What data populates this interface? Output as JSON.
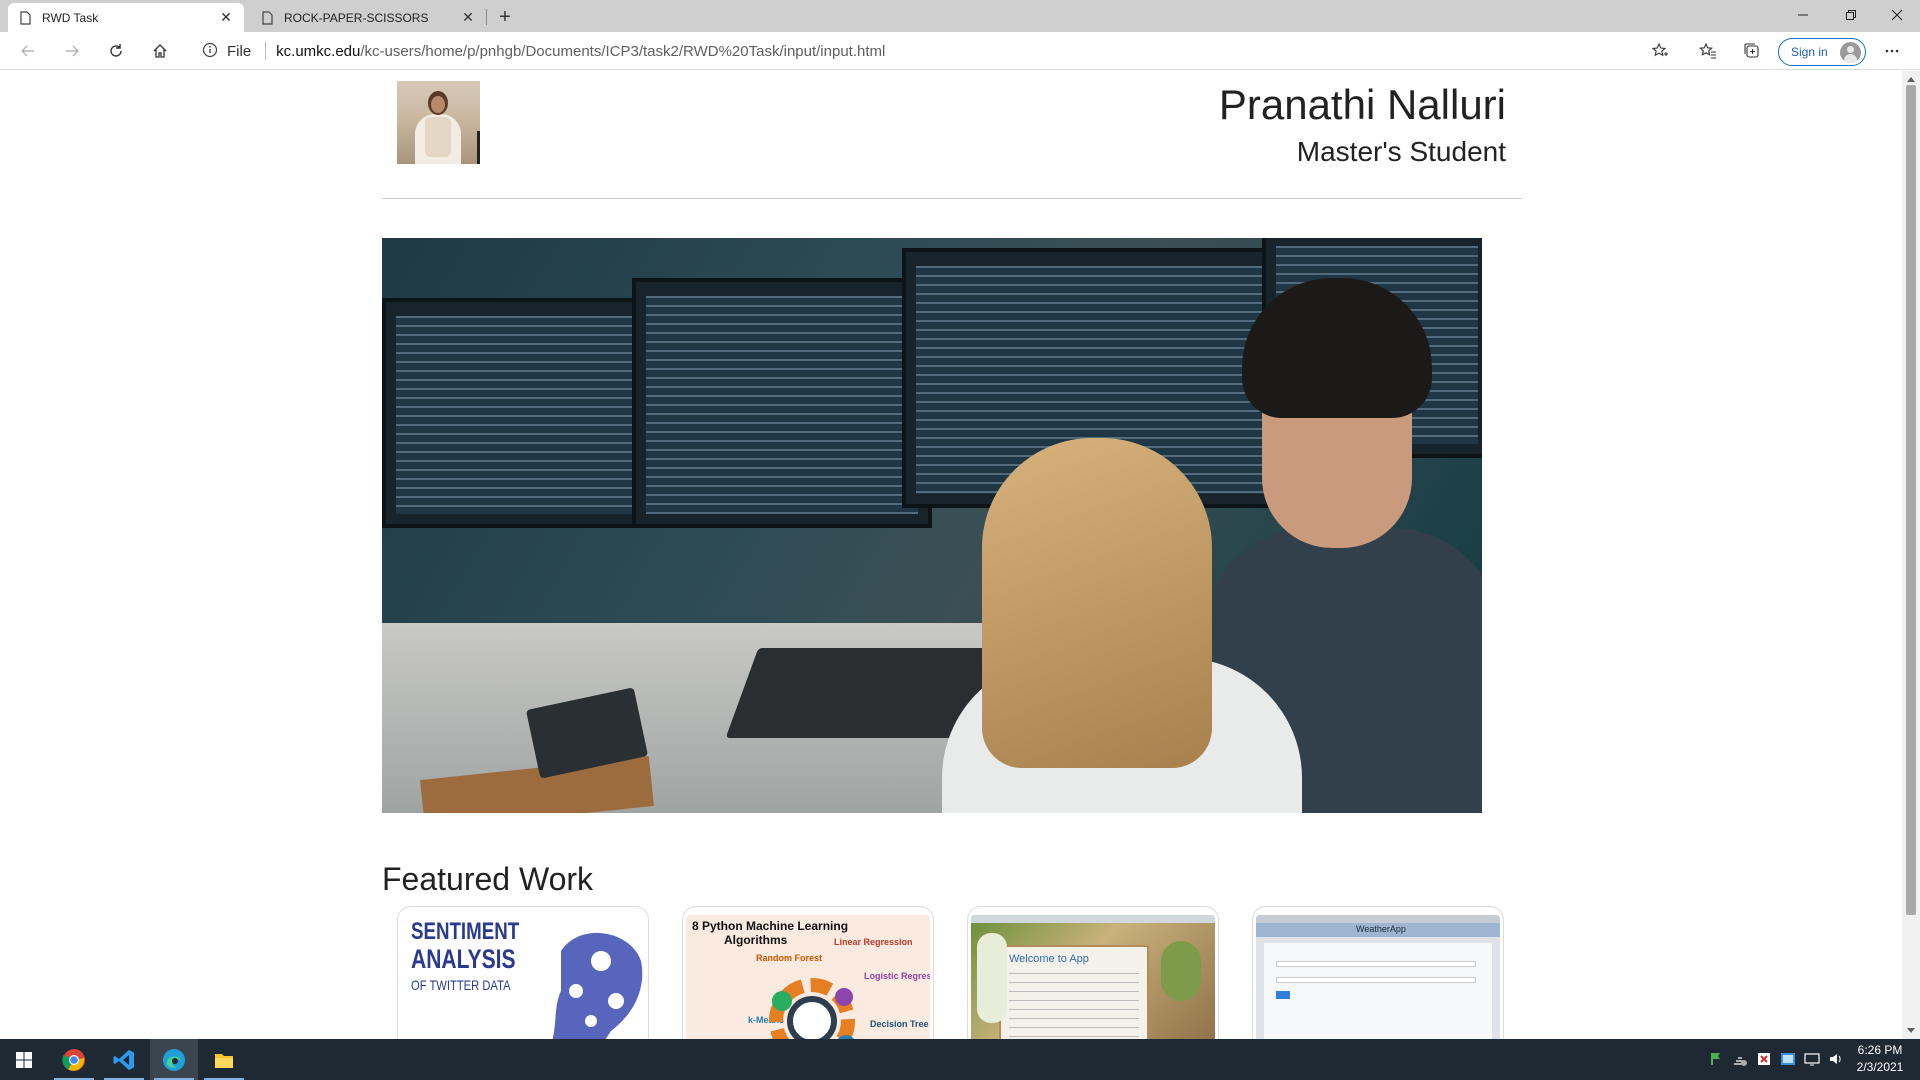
{
  "browser": {
    "tabs": [
      {
        "title": "RWD Task",
        "active": true
      },
      {
        "title": "ROCK-PAPER-SCISSORS",
        "active": false
      }
    ],
    "address": {
      "scheme_label": "File",
      "host": "kc.umkc.edu",
      "path": "/kc-users/home/p/pnhgb/Documents/ICP3/task2/RWD%20Task/input/input.html"
    },
    "signin_label": "Sign in",
    "icons": [
      "back-icon",
      "forward-icon",
      "refresh-icon",
      "home-icon",
      "info-icon",
      "add-favorite-icon",
      "favorites-icon",
      "collections-icon",
      "more-icon"
    ]
  },
  "page": {
    "name": "Pranathi Nalluri",
    "role": "Master's Student",
    "featured_title": "Featured Work",
    "cards": [
      {
        "title_line1": "SENTIMENT",
        "title_line2": "ANALYSIS",
        "title_line3": "OF TWITTER DATA"
      },
      {
        "title_line1": "8 Python Machine Learning",
        "title_line2": "Algorithms",
        "labels": [
          "Linear Regression",
          "Random Forest",
          "Logistic Regression",
          "k-Means",
          "Decision Tree"
        ]
      },
      {
        "title_line1": "Welcome to App"
      },
      {
        "title_line1": "WeatherApp"
      }
    ]
  },
  "taskbar": {
    "apps": [
      "windows-start-icon",
      "chrome-icon",
      "vscode-icon",
      "edge-icon",
      "file-explorer-icon"
    ],
    "time": "6:26 PM",
    "date": "2/3/2021"
  },
  "colors": {
    "accent": "#1a6fc6",
    "taskbar": "#1e2933",
    "tabstrip": "#cfcfcf"
  }
}
